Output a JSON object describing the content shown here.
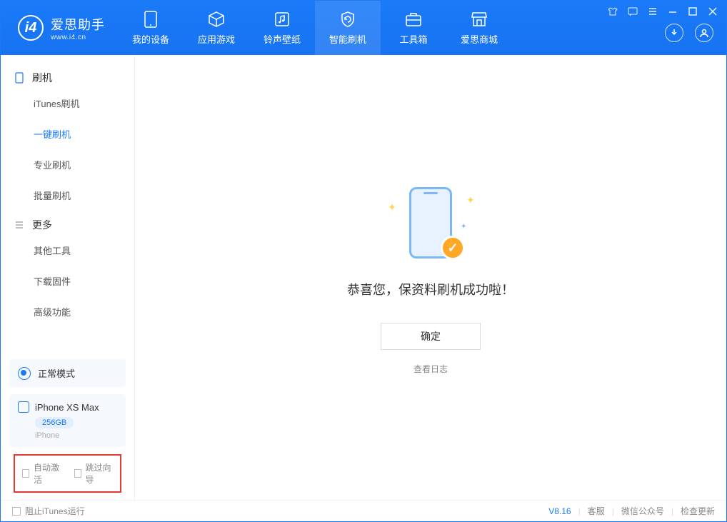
{
  "app": {
    "title": "爱思助手",
    "subtitle": "www.i4.cn"
  },
  "nav": {
    "items": [
      {
        "label": "我的设备"
      },
      {
        "label": "应用游戏"
      },
      {
        "label": "铃声壁纸"
      },
      {
        "label": "智能刷机"
      },
      {
        "label": "工具箱"
      },
      {
        "label": "爱思商城"
      }
    ]
  },
  "sidebar": {
    "group1": "刷机",
    "items1": [
      "iTunes刷机",
      "一键刷机",
      "专业刷机",
      "批量刷机"
    ],
    "group2": "更多",
    "items2": [
      "其他工具",
      "下载固件",
      "高级功能"
    ],
    "mode": "正常模式",
    "device": {
      "name": "iPhone XS Max",
      "storage": "256GB",
      "type": "iPhone"
    },
    "opt1": "自动激活",
    "opt2": "跳过向导"
  },
  "main": {
    "success_title": "恭喜您，保资料刷机成功啦！",
    "ok_button": "确定",
    "view_log": "查看日志"
  },
  "footer": {
    "block_itunes": "阻止iTunes运行",
    "version": "V8.16",
    "links": [
      "客服",
      "微信公众号",
      "检查更新"
    ]
  }
}
